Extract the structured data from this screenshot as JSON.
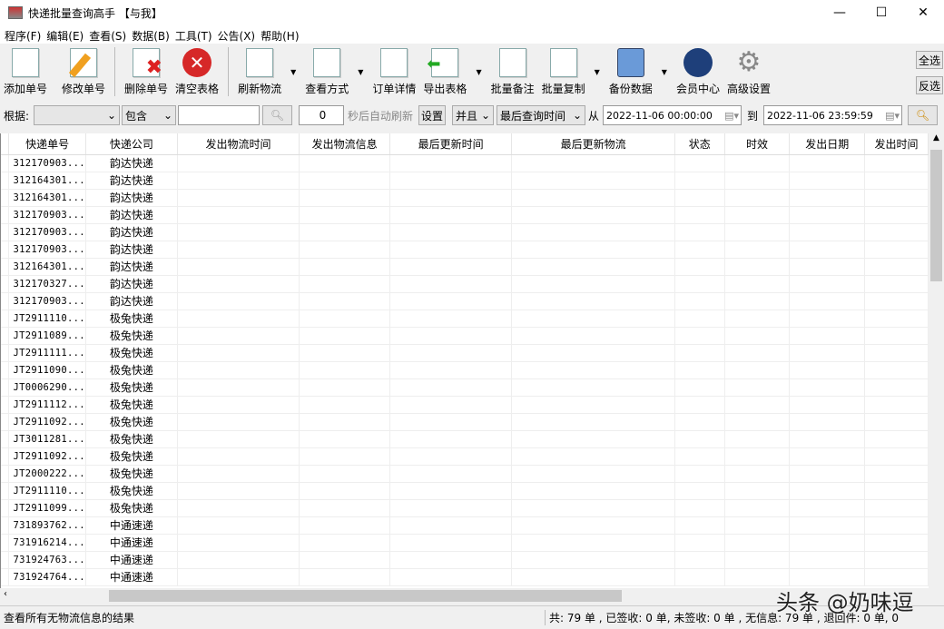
{
  "window": {
    "title": "快递批量查询高手 【与我】",
    "minimize": "—",
    "maximize": "☐",
    "close": "✕"
  },
  "menu": [
    "程序(F)",
    "编辑(E)",
    "查看(S)",
    "数据(B)",
    "工具(T)",
    "公告(X)",
    "帮助(H)"
  ],
  "toolbar": {
    "add": "添加单号",
    "edit": "修改单号",
    "delete": "删除单号",
    "clear": "清空表格",
    "refresh": "刷新物流",
    "view": "查看方式",
    "detail": "订单详情",
    "export": "导出表格",
    "note": "批量备注",
    "copy": "批量复制",
    "backup": "备份数据",
    "member": "会员中心",
    "settings": "高级设置",
    "select_all": "全选",
    "invert": "反选"
  },
  "filter": {
    "label": "根据:",
    "field_value": "",
    "match": "包含",
    "keyword": "",
    "refresh_seconds": "0",
    "auto_refresh_label": "秒后自动刷新",
    "set_button": "设置",
    "logic": "并且",
    "time_field": "最后查询时间",
    "from_label": "从",
    "from": "2022-11-06 00:00:00",
    "to_label": "到",
    "to": "2022-11-06 23:59:59"
  },
  "table": {
    "columns": [
      "快递单号",
      "快递公司",
      "发出物流时间",
      "发出物流信息",
      "最后更新时间",
      "最后更新物流",
      "状态",
      "时效",
      "发出日期",
      "发出时间"
    ],
    "rows": [
      [
        "312170903...",
        "韵达快递"
      ],
      [
        "312164301...",
        "韵达快递"
      ],
      [
        "312164301...",
        "韵达快递"
      ],
      [
        "312170903...",
        "韵达快递"
      ],
      [
        "312170903...",
        "韵达快递"
      ],
      [
        "312170903...",
        "韵达快递"
      ],
      [
        "312164301...",
        "韵达快递"
      ],
      [
        "312170327...",
        "韵达快递"
      ],
      [
        "312170903...",
        "韵达快递"
      ],
      [
        "JT2911110...",
        "极兔快递"
      ],
      [
        "JT2911089...",
        "极兔快递"
      ],
      [
        "JT2911111...",
        "极兔快递"
      ],
      [
        "JT2911090...",
        "极兔快递"
      ],
      [
        "JT0006290...",
        "极兔快递"
      ],
      [
        "JT2911112...",
        "极兔快递"
      ],
      [
        "JT2911092...",
        "极兔快递"
      ],
      [
        "JT3011281...",
        "极兔快递"
      ],
      [
        "JT2911092...",
        "极兔快递"
      ],
      [
        "JT2000222...",
        "极兔快递"
      ],
      [
        "JT2911110...",
        "极兔快递"
      ],
      [
        "JT2911099...",
        "极兔快递"
      ],
      [
        "731893762...",
        "中通速递"
      ],
      [
        "731916214...",
        "中通速递"
      ],
      [
        "731924763...",
        "中通速递"
      ],
      [
        "731924764...",
        "中通速递"
      ]
    ]
  },
  "status": {
    "left": "查看所有无物流信息的结果",
    "right": "共: 79 单 , 已签收:  0 单, 未签收:  0 单 , 无信息: 79 单 , 退回件: 0 单,  0"
  },
  "watermark": "头条 @奶味逗"
}
